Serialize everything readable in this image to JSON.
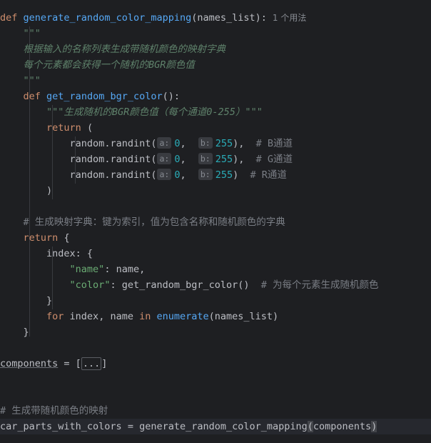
{
  "code": {
    "l1_def": "def",
    "l1_fname": "generate_random_color_mapping",
    "l1_params": "(names_list):",
    "l1_usage": "1 个用法",
    "doc_open": "\"\"\"",
    "doc_line1": "根据输入的名称列表生成带随机颜色的映射字典",
    "doc_line2": "每个元素都会获得一个随机的BGR颜色值",
    "doc_close": "\"\"\"",
    "inner_def": "def",
    "inner_fname": "get_random_bgr_color",
    "inner_params": "():",
    "inner_doc": "\"\"\"生成随机的BGR颜色值（每个通道0-255）\"\"\"",
    "return_kw": "return",
    "return_paren": "(",
    "randint_call": "random.randint(",
    "hint_a": "a:",
    "hint_b": "b:",
    "zero": "0",
    "comma": ",",
    "max": "255",
    "close_comma": "),",
    "close": ")",
    "comment_b": "# B通道",
    "comment_g": "# G通道",
    "comment_r": "# R通道",
    "close_paren_line": ")",
    "comment_dict": "# 生成映射字典：键为索引，值为包含名称和随机颜色的字典",
    "return_brace": "{",
    "index_key": "index",
    "colon_brace": ": {",
    "name_key": "\"name\"",
    "name_val": ": name,",
    "color_key": "\"color\"",
    "color_val": ": get_random_bgr_color()",
    "comment_color": "# 为每个元素生成随机颜色",
    "close_brace": "}",
    "for_kw": "for",
    "for_vars": " index, name ",
    "in_kw": "in",
    "enumerate_fn": "enumerate",
    "enum_args": "(names_list)",
    "close_brace2": "}",
    "components_var": "components",
    "assign_eq": " = ",
    "bracket_open": "[",
    "fold_text": "...",
    "bracket_close": "]",
    "comment_map": "# 生成带随机颜色的映射",
    "result_var": "car_parts_with_colors",
    "call_fn": "generate_random_color_mapping",
    "call_open": "(",
    "call_arg": "components",
    "call_close": ")"
  },
  "colors": {
    "background": "#1e1f22",
    "keyword": "#cf8e6d",
    "function": "#56a8f5",
    "docstring": "#5f826b",
    "comment": "#7a7e85",
    "number": "#2aacb8",
    "string": "#6aab73",
    "text": "#bcbec4"
  }
}
